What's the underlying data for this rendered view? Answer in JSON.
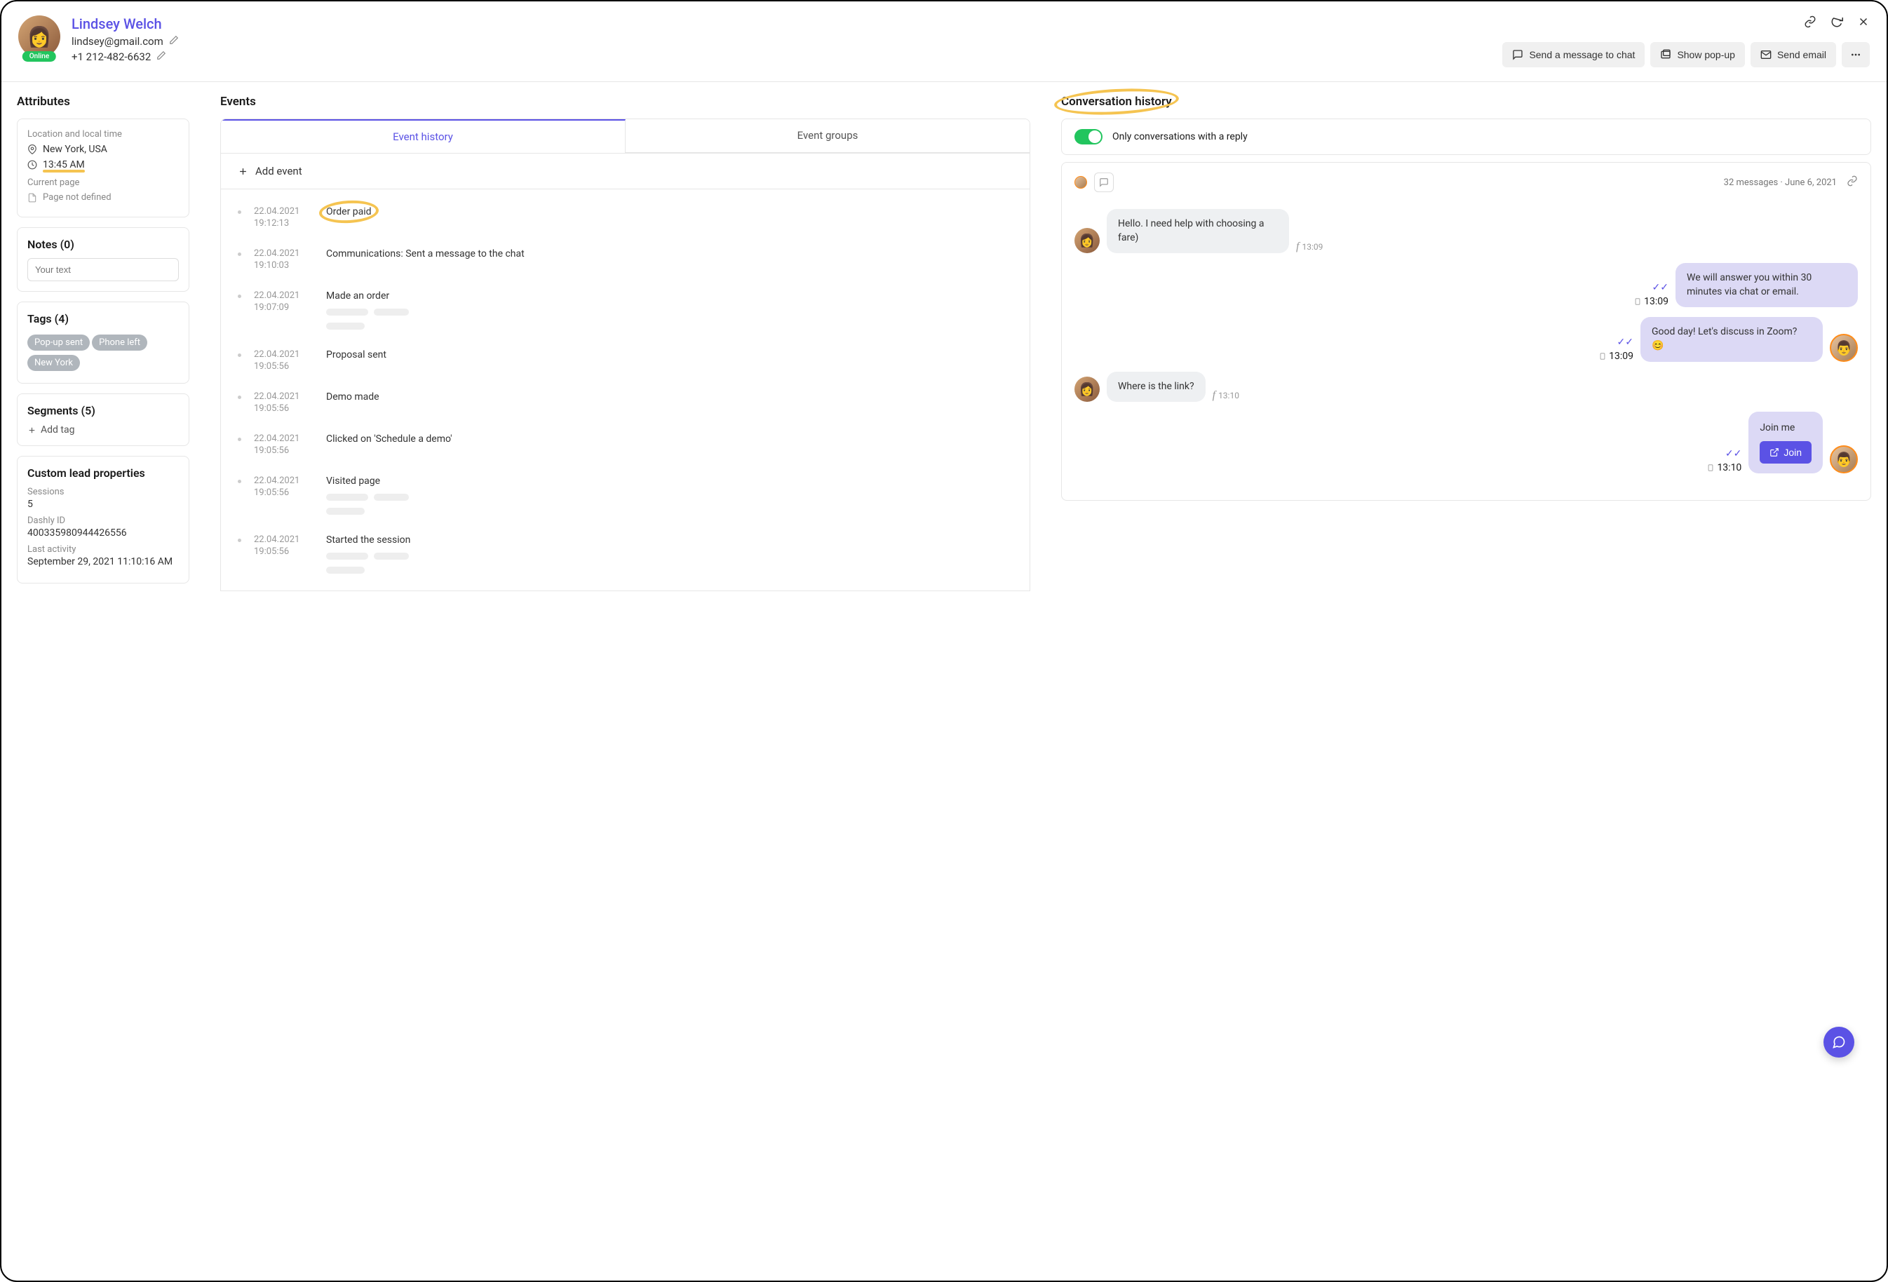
{
  "profile": {
    "name": "Lindsey Welch",
    "email": "lindsey@gmail.com",
    "phone": "+1 212-482-6632",
    "status": "Online"
  },
  "header_actions": {
    "send_chat": "Send a message to chat",
    "show_popup": "Show pop-up",
    "send_email": "Send email"
  },
  "attributes": {
    "title": "Attributes",
    "location_label": "Location and local time",
    "location": "New York, USA",
    "time": "13:45 AM",
    "current_page_label": "Current page",
    "current_page": "Page not defined",
    "notes": {
      "title": "Notes (0)",
      "placeholder": "Your text"
    },
    "tags": {
      "title": "Tags (4)",
      "items": [
        "Pop-up sent",
        "Phone left",
        "New York"
      ]
    },
    "segments": {
      "title": "Segments (5)",
      "add_tag": "Add tag"
    },
    "custom": {
      "title": "Custom lead properties",
      "sessions_label": "Sessions",
      "sessions": "5",
      "dashly_label": "Dashly ID",
      "dashly_id": "400335980944426556",
      "last_activity_label": "Last activity",
      "last_activity": "September 29, 2021 11:10:16 AM"
    }
  },
  "events": {
    "title": "Events",
    "tab_history": "Event history",
    "tab_groups": "Event groups",
    "add_event": "Add event",
    "items": [
      {
        "date": "22.04.2021",
        "time": "19:12:13",
        "text": "Order paid",
        "highlight": true
      },
      {
        "date": "22.04.2021",
        "time": "19:10:03",
        "text": "Communications: Sent a message to the chat"
      },
      {
        "date": "22.04.2021",
        "time": "19:07:09",
        "text": "Made an order",
        "placeholder": true
      },
      {
        "date": "22.04.2021",
        "time": "19:05:56",
        "text": "Proposal sent"
      },
      {
        "date": "22.04.2021",
        "time": "19:05:56",
        "text": "Demo made"
      },
      {
        "date": "22.04.2021",
        "time": "19:05:56",
        "text": "Clicked on 'Schedule a demo'"
      },
      {
        "date": "22.04.2021",
        "time": "19:05:56",
        "text": "Visited page",
        "placeholder": true
      },
      {
        "date": "22.04.2021",
        "time": "19:05:56",
        "text": "Started the session",
        "placeholder": true
      }
    ]
  },
  "conversation": {
    "title": "Conversation history",
    "toggle_label": "Only conversations with a reply",
    "summary": "32 messages · June 6, 2021",
    "messages": [
      {
        "side": "in",
        "text": "Hello. I need help with choosing a fare)",
        "time": "13:09",
        "icon": "f"
      },
      {
        "side": "out",
        "text": "We will answer you within 30 minutes via chat or email.",
        "time": "13:09",
        "icon": "mobile"
      },
      {
        "side": "out",
        "text": "Good day! Let's discuss in Zoom? 😊",
        "time": "13:09",
        "icon": "mobile",
        "agent": true
      },
      {
        "side": "in",
        "text": "Where is the link?",
        "time": "13:10",
        "icon": "f"
      },
      {
        "side": "out",
        "text": "Join me",
        "time": "13:10",
        "icon": "mobile",
        "join": true,
        "join_label": "Join",
        "agent": true
      }
    ]
  }
}
